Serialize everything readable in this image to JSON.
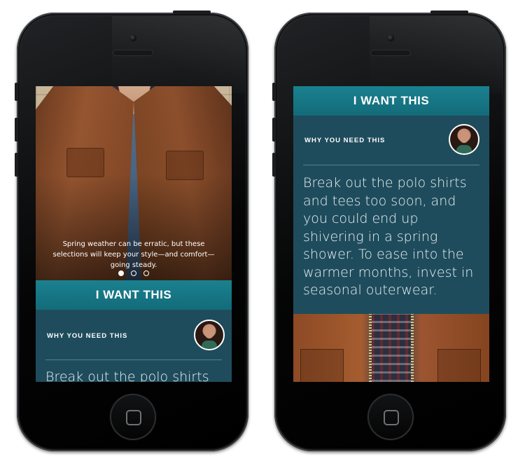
{
  "left_phone": {
    "hero_caption": "Spring weather can be erratic, but these selections will keep your style—and comfort—going steady.",
    "carousel": {
      "count": 3,
      "active_index": 0
    },
    "cta_label": "I WANT THIS",
    "why_label": "WHY YOU NEED THIS",
    "body_text_visible": "Break out the polo shirts"
  },
  "right_phone": {
    "cta_label": "I WANT THIS",
    "why_label": "WHY YOU NEED THIS",
    "body_text": "Break out the polo shirts and tees too soon, and you could end up shivering in a spring shower. To ease into the warmer months, invest in seasonal outerwear."
  },
  "colors": {
    "cta_bar": "#1a8190",
    "panel": "#1f4c5c",
    "text": "#ffffff"
  }
}
